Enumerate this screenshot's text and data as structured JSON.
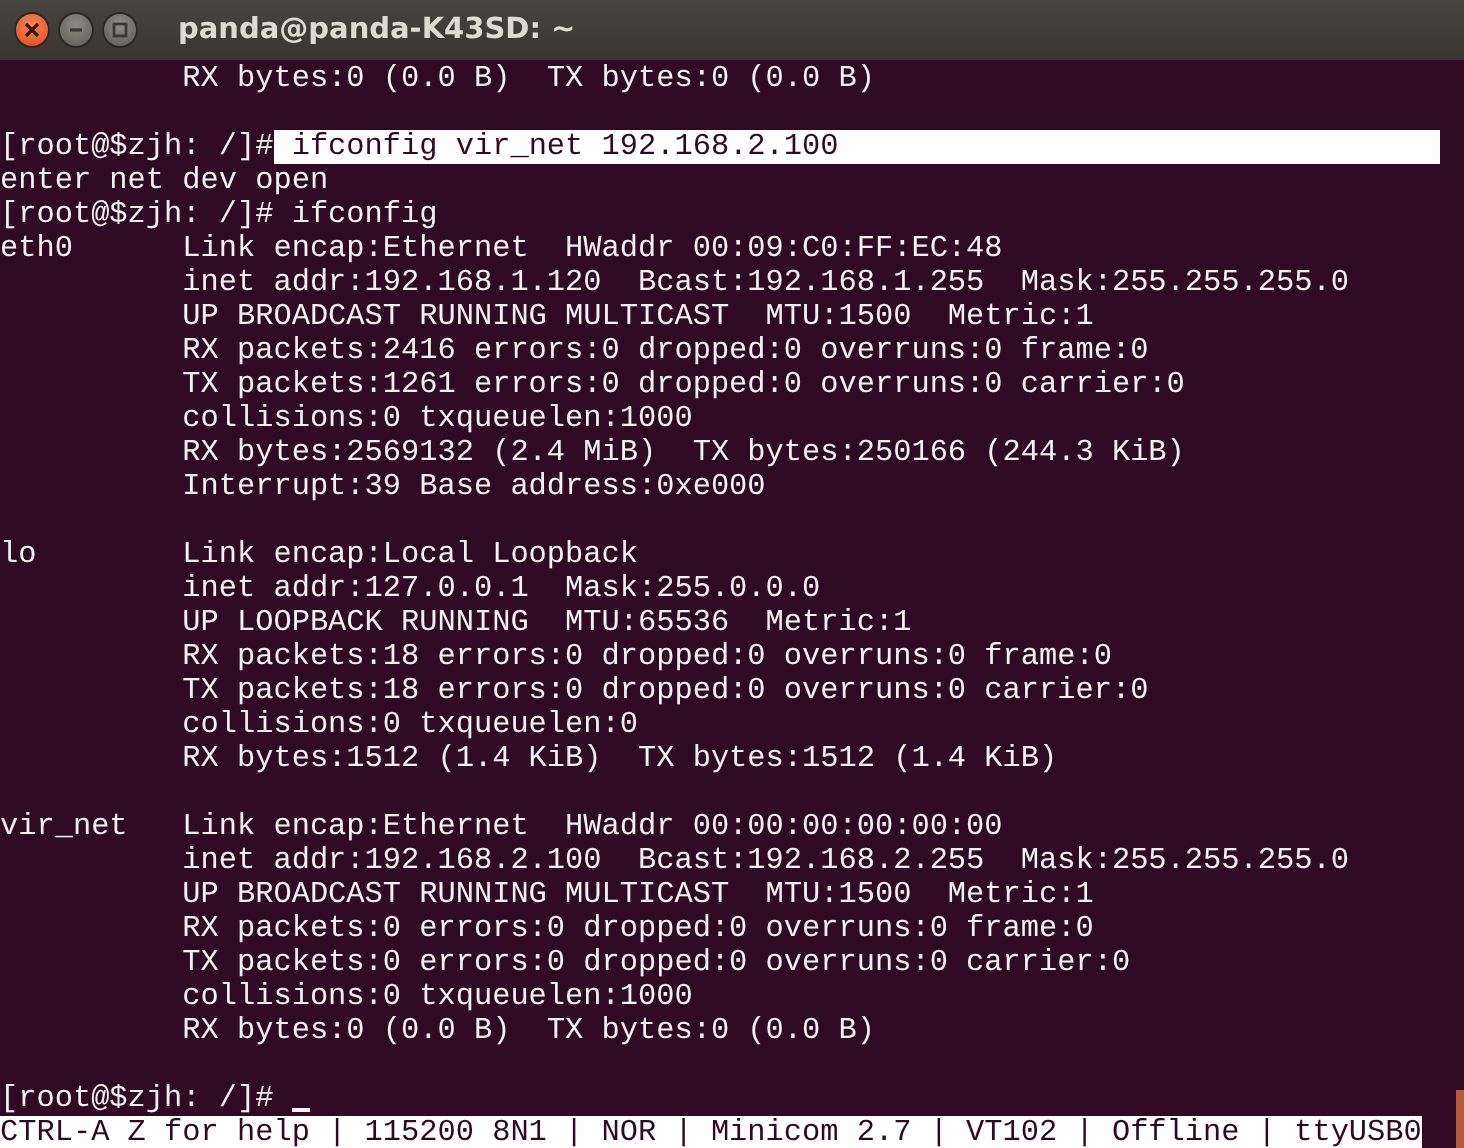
{
  "window": {
    "title": "panda@panda-K43SD: ~"
  },
  "terminal": {
    "lines": [
      {
        "kind": "output",
        "text": "          RX bytes:0 (0.0 B)  TX bytes:0 (0.0 B)"
      },
      {
        "kind": "blank"
      },
      {
        "kind": "prompt",
        "prompt": "[root@$zjh: /]#",
        "command": " ifconfig vir_net 192.168.2.100",
        "selected": true
      },
      {
        "kind": "output",
        "text": "enter net dev open"
      },
      {
        "kind": "prompt",
        "prompt": "[root@$zjh: /]#",
        "command": " ifconfig",
        "selected": false
      },
      {
        "kind": "output",
        "text": "eth0      Link encap:Ethernet  HWaddr 00:09:C0:FF:EC:48"
      },
      {
        "kind": "output",
        "text": "          inet addr:192.168.1.120  Bcast:192.168.1.255  Mask:255.255.255.0"
      },
      {
        "kind": "output",
        "text": "          UP BROADCAST RUNNING MULTICAST  MTU:1500  Metric:1"
      },
      {
        "kind": "output",
        "text": "          RX packets:2416 errors:0 dropped:0 overruns:0 frame:0"
      },
      {
        "kind": "output",
        "text": "          TX packets:1261 errors:0 dropped:0 overruns:0 carrier:0"
      },
      {
        "kind": "output",
        "text": "          collisions:0 txqueuelen:1000"
      },
      {
        "kind": "output",
        "text": "          RX bytes:2569132 (2.4 MiB)  TX bytes:250166 (244.3 KiB)"
      },
      {
        "kind": "output",
        "text": "          Interrupt:39 Base address:0xe000"
      },
      {
        "kind": "blank"
      },
      {
        "kind": "output",
        "text": "lo        Link encap:Local Loopback"
      },
      {
        "kind": "output",
        "text": "          inet addr:127.0.0.1  Mask:255.0.0.0"
      },
      {
        "kind": "output",
        "text": "          UP LOOPBACK RUNNING  MTU:65536  Metric:1"
      },
      {
        "kind": "output",
        "text": "          RX packets:18 errors:0 dropped:0 overruns:0 frame:0"
      },
      {
        "kind": "output",
        "text": "          TX packets:18 errors:0 dropped:0 overruns:0 carrier:0"
      },
      {
        "kind": "output",
        "text": "          collisions:0 txqueuelen:0"
      },
      {
        "kind": "output",
        "text": "          RX bytes:1512 (1.4 KiB)  TX bytes:1512 (1.4 KiB)"
      },
      {
        "kind": "blank"
      },
      {
        "kind": "output",
        "text": "vir_net   Link encap:Ethernet  HWaddr 00:00:00:00:00:00"
      },
      {
        "kind": "output",
        "text": "          inet addr:192.168.2.100  Bcast:192.168.2.255  Mask:255.255.255.0"
      },
      {
        "kind": "output",
        "text": "          UP BROADCAST RUNNING MULTICAST  MTU:1500  Metric:1"
      },
      {
        "kind": "output",
        "text": "          RX packets:0 errors:0 dropped:0 overruns:0 frame:0"
      },
      {
        "kind": "output",
        "text": "          TX packets:0 errors:0 dropped:0 overruns:0 carrier:0"
      },
      {
        "kind": "output",
        "text": "          collisions:0 txqueuelen:1000"
      },
      {
        "kind": "output",
        "text": "          RX bytes:0 (0.0 B)  TX bytes:0 (0.0 B)"
      },
      {
        "kind": "blank"
      },
      {
        "kind": "prompt",
        "prompt": "[root@$zjh: /]#",
        "cursor": true
      }
    ]
  },
  "status_bar": {
    "text": "CTRL-A Z for help | 115200 8N1 | NOR | Minicom 2.7 | VT102 | Offline | ttyUSB0"
  }
}
